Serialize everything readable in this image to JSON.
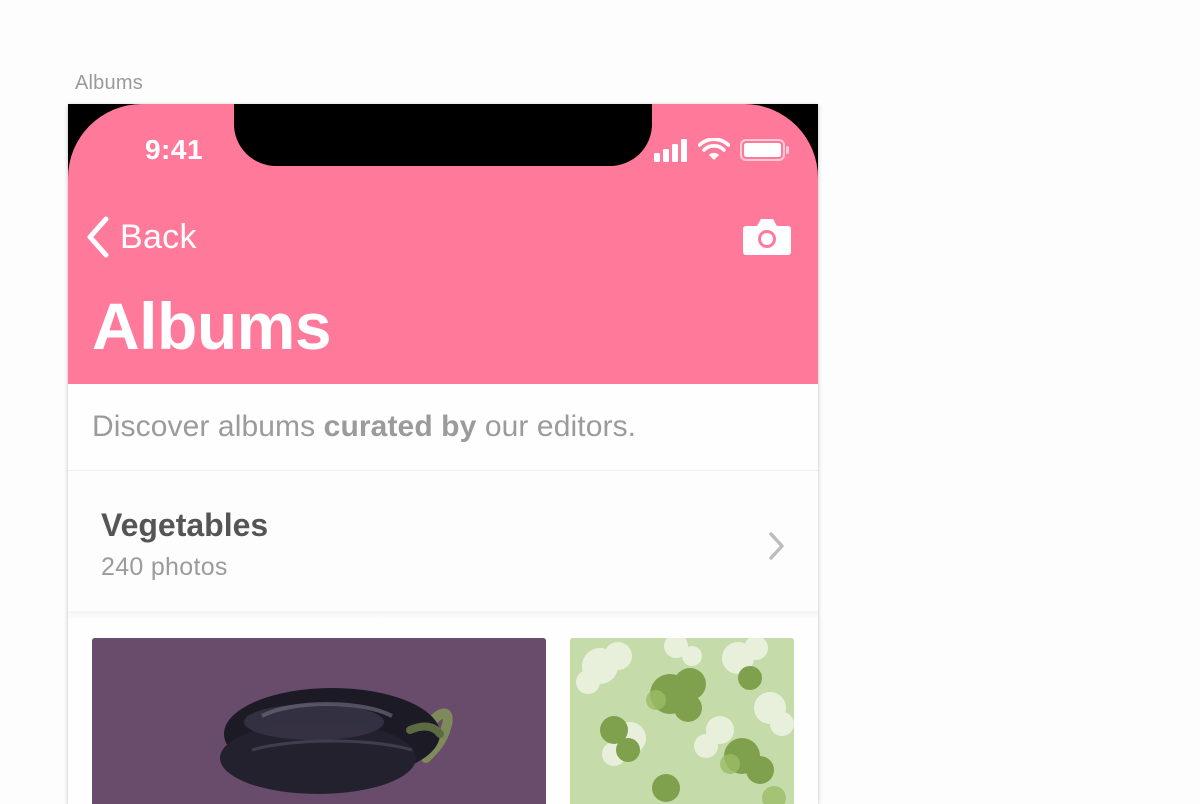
{
  "artboard": {
    "label": "Albums"
  },
  "status_bar": {
    "time": "9:41"
  },
  "nav": {
    "back_label": "Back",
    "back_icon": "chevron-left-icon",
    "action_icon": "camera-icon"
  },
  "page": {
    "title": "Albums"
  },
  "intro": {
    "prefix": "Discover albums ",
    "emphasis": "curated by",
    "suffix": " our editors."
  },
  "album": {
    "title": "Vegetables",
    "count": "240 photos",
    "chevron_icon": "chevron-right-icon",
    "photos": [
      {
        "name": "eggplant-photo",
        "subject": "eggplant"
      },
      {
        "name": "broccoli-photo",
        "subject": "broccoli"
      }
    ]
  },
  "colors": {
    "header": "#ff7a9a",
    "text_secondary": "#9b9b9b",
    "text_primary": "#555555",
    "photo_main_bg": "#6e5070",
    "photo_side_bg": "#c5dcaa"
  }
}
